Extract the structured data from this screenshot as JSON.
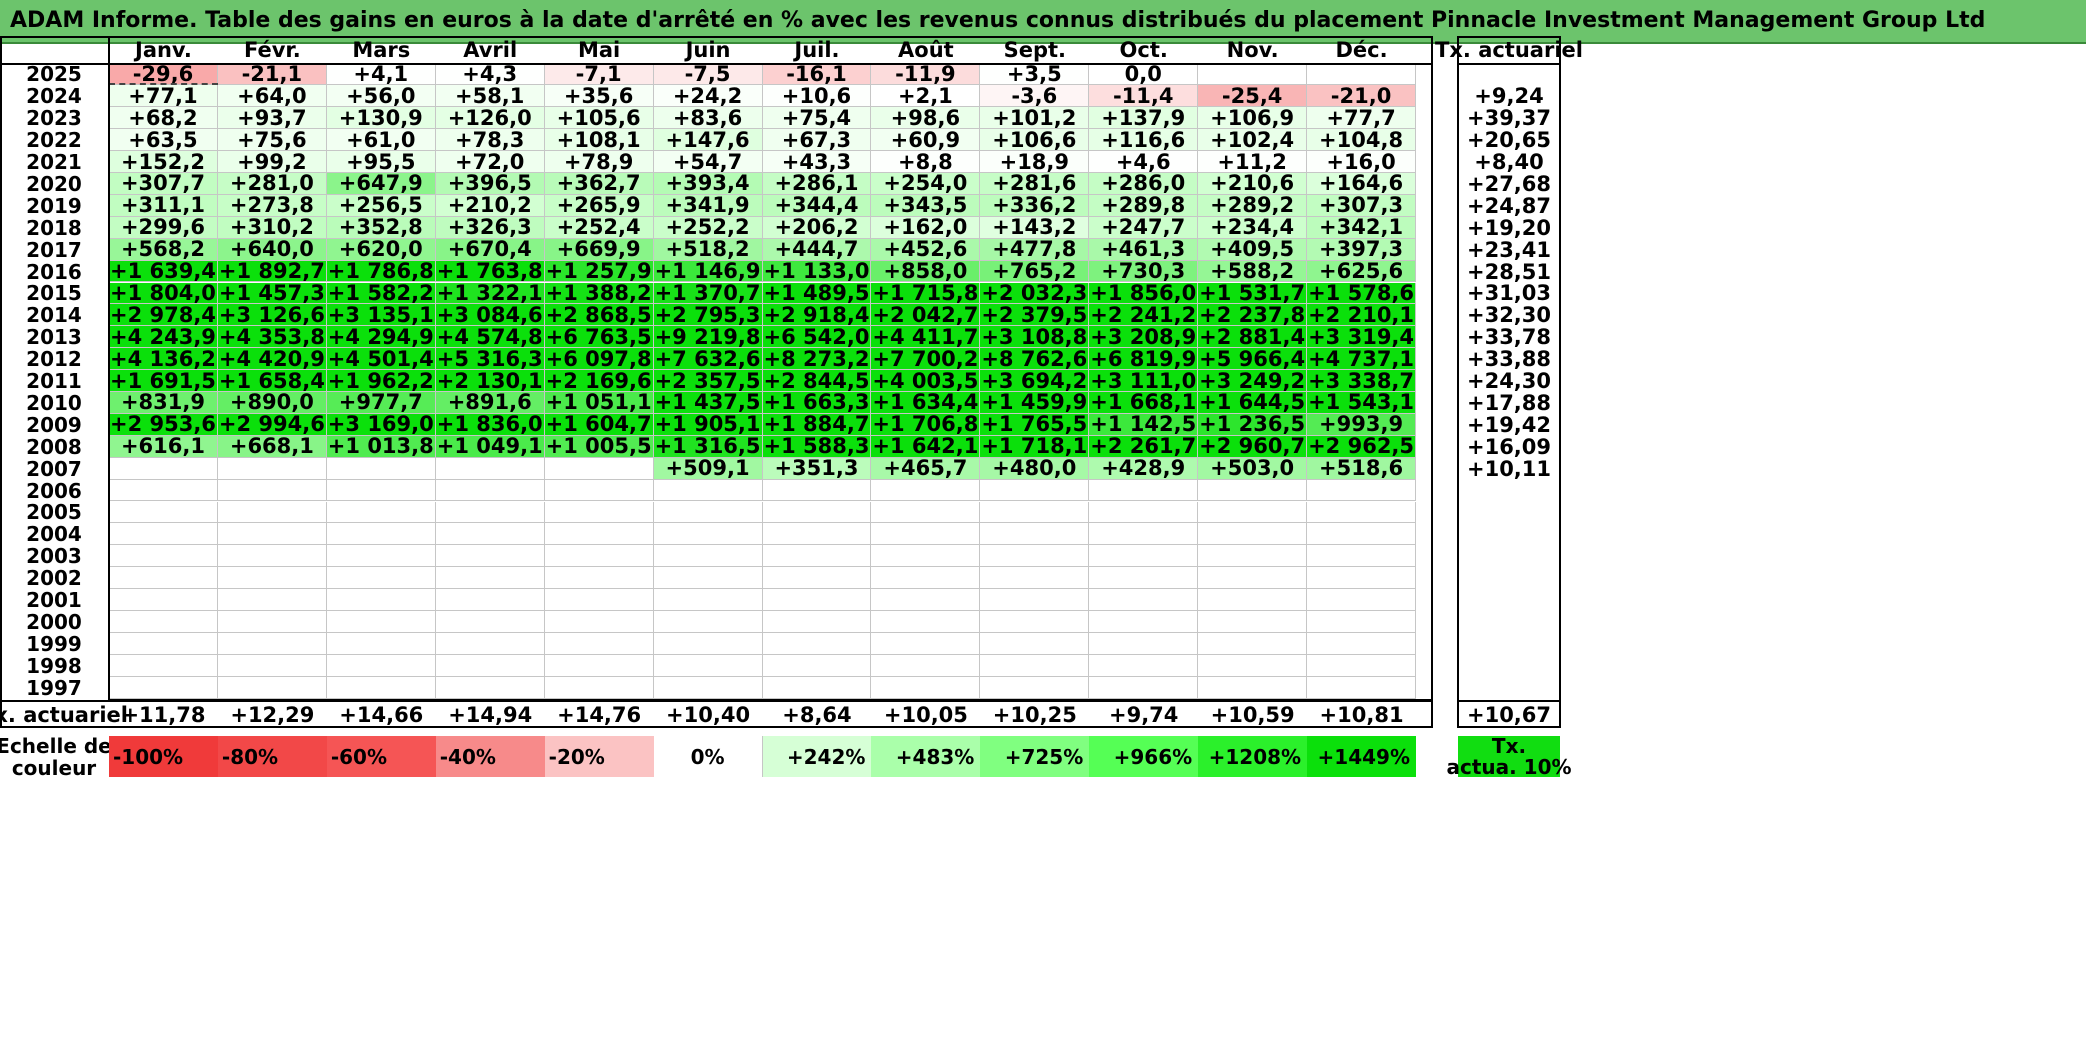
{
  "title": "ADAM Informe. Table des gains en euros à la date d'arrêté en % avec les revenus connus distribués du placement Pinnacle Investment Management Group Ltd",
  "months": [
    "Janv.",
    "Févr.",
    "Mars",
    "Avril",
    "Mai",
    "Juin",
    "Juil.",
    "Août",
    "Sept.",
    "Oct.",
    "Nov.",
    "Déc."
  ],
  "tx_header": "Tx. actuariel",
  "rows": [
    {
      "year": "2025",
      "values": [
        "-29,6",
        "-21,1",
        "+4,1",
        "+4,3",
        "-7,1",
        "-7,5",
        "-16,1",
        "-11,9",
        "+3,5",
        "0,0",
        "",
        ""
      ],
      "tx": ""
    },
    {
      "year": "2024",
      "values": [
        "+77,1",
        "+64,0",
        "+56,0",
        "+58,1",
        "+35,6",
        "+24,2",
        "+10,6",
        "+2,1",
        "-3,6",
        "-11,4",
        "-25,4",
        "-21,0"
      ],
      "tx": "+9,24"
    },
    {
      "year": "2023",
      "values": [
        "+68,2",
        "+93,7",
        "+130,9",
        "+126,0",
        "+105,6",
        "+83,6",
        "+75,4",
        "+98,6",
        "+101,2",
        "+137,9",
        "+106,9",
        "+77,7"
      ],
      "tx": "+39,37"
    },
    {
      "year": "2022",
      "values": [
        "+63,5",
        "+75,6",
        "+61,0",
        "+78,3",
        "+108,1",
        "+147,6",
        "+67,3",
        "+60,9",
        "+106,6",
        "+116,6",
        "+102,4",
        "+104,8"
      ],
      "tx": "+20,65"
    },
    {
      "year": "2021",
      "values": [
        "+152,2",
        "+99,2",
        "+95,5",
        "+72,0",
        "+78,9",
        "+54,7",
        "+43,3",
        "+8,8",
        "+18,9",
        "+4,6",
        "+11,2",
        "+16,0"
      ],
      "tx": "+8,40"
    },
    {
      "year": "2020",
      "values": [
        "+307,7",
        "+281,0",
        "+647,9",
        "+396,5",
        "+362,7",
        "+393,4",
        "+286,1",
        "+254,0",
        "+281,6",
        "+286,0",
        "+210,6",
        "+164,6"
      ],
      "tx": "+27,68"
    },
    {
      "year": "2019",
      "values": [
        "+311,1",
        "+273,8",
        "+256,5",
        "+210,2",
        "+265,9",
        "+341,9",
        "+344,4",
        "+343,5",
        "+336,2",
        "+289,8",
        "+289,2",
        "+307,3"
      ],
      "tx": "+24,87"
    },
    {
      "year": "2018",
      "values": [
        "+299,6",
        "+310,2",
        "+352,8",
        "+326,3",
        "+252,4",
        "+252,2",
        "+206,2",
        "+162,0",
        "+143,2",
        "+247,7",
        "+234,4",
        "+342,1"
      ],
      "tx": "+19,20"
    },
    {
      "year": "2017",
      "values": [
        "+568,2",
        "+640,0",
        "+620,0",
        "+670,4",
        "+669,9",
        "+518,2",
        "+444,7",
        "+452,6",
        "+477,8",
        "+461,3",
        "+409,5",
        "+397,3"
      ],
      "tx": "+23,41"
    },
    {
      "year": "2016",
      "values": [
        "+1 639,4",
        "+1 892,7",
        "+1 786,8",
        "+1 763,8",
        "+1 257,9",
        "+1 146,9",
        "+1 133,0",
        "+858,0",
        "+765,2",
        "+730,3",
        "+588,2",
        "+625,6"
      ],
      "tx": "+28,51"
    },
    {
      "year": "2015",
      "values": [
        "+1 804,0",
        "+1 457,3",
        "+1 582,2",
        "+1 322,1",
        "+1 388,2",
        "+1 370,7",
        "+1 489,5",
        "+1 715,8",
        "+2 032,3",
        "+1 856,0",
        "+1 531,7",
        "+1 578,6"
      ],
      "tx": "+31,03"
    },
    {
      "year": "2014",
      "values": [
        "+2 978,4",
        "+3 126,6",
        "+3 135,1",
        "+3 084,6",
        "+2 868,5",
        "+2 795,3",
        "+2 918,4",
        "+2 042,7",
        "+2 379,5",
        "+2 241,2",
        "+2 237,8",
        "+2 210,1"
      ],
      "tx": "+32,30"
    },
    {
      "year": "2013",
      "values": [
        "+4 243,9",
        "+4 353,8",
        "+4 294,9",
        "+4 574,8",
        "+6 763,5",
        "+9 219,8",
        "+6 542,0",
        "+4 411,7",
        "+3 108,8",
        "+3 208,9",
        "+2 881,4",
        "+3 319,4"
      ],
      "tx": "+33,78"
    },
    {
      "year": "2012",
      "values": [
        "+4 136,2",
        "+4 420,9",
        "+4 501,4",
        "+5 316,3",
        "+6 097,8",
        "+7 632,6",
        "+8 273,2",
        "+7 700,2",
        "+8 762,6",
        "+6 819,9",
        "+5 966,4",
        "+4 737,1"
      ],
      "tx": "+33,88"
    },
    {
      "year": "2011",
      "values": [
        "+1 691,5",
        "+1 658,4",
        "+1 962,2",
        "+2 130,1",
        "+2 169,6",
        "+2 357,5",
        "+2 844,5",
        "+4 003,5",
        "+3 694,2",
        "+3 111,0",
        "+3 249,2",
        "+3 338,7"
      ],
      "tx": "+24,30"
    },
    {
      "year": "2010",
      "values": [
        "+831,9",
        "+890,0",
        "+977,7",
        "+891,6",
        "+1 051,1",
        "+1 437,5",
        "+1 663,3",
        "+1 634,4",
        "+1 459,9",
        "+1 668,1",
        "+1 644,5",
        "+1 543,1"
      ],
      "tx": "+17,88"
    },
    {
      "year": "2009",
      "values": [
        "+2 953,6",
        "+2 994,6",
        "+3 169,0",
        "+1 836,0",
        "+1 604,7",
        "+1 905,1",
        "+1 884,7",
        "+1 706,8",
        "+1 765,5",
        "+1 142,5",
        "+1 236,5",
        "+993,9"
      ],
      "tx": "+19,42"
    },
    {
      "year": "2008",
      "values": [
        "+616,1",
        "+668,1",
        "+1 013,8",
        "+1 049,1",
        "+1 005,5",
        "+1 316,5",
        "+1 588,3",
        "+1 642,1",
        "+1 718,1",
        "+2 261,7",
        "+2 960,7",
        "+2 962,5"
      ],
      "tx": "+16,09"
    },
    {
      "year": "2007",
      "values": [
        "",
        "",
        "",
        "",
        "",
        "+509,1",
        "+351,3",
        "+465,7",
        "+480,0",
        "+428,9",
        "+503,0",
        "+518,6"
      ],
      "tx": "+10,11"
    },
    {
      "year": "2006",
      "values": [
        "",
        "",
        "",
        "",
        "",
        "",
        "",
        "",
        "",
        "",
        "",
        ""
      ],
      "tx": ""
    },
    {
      "year": "2005",
      "values": [
        "",
        "",
        "",
        "",
        "",
        "",
        "",
        "",
        "",
        "",
        "",
        ""
      ],
      "tx": ""
    },
    {
      "year": "2004",
      "values": [
        "",
        "",
        "",
        "",
        "",
        "",
        "",
        "",
        "",
        "",
        "",
        ""
      ],
      "tx": ""
    },
    {
      "year": "2003",
      "values": [
        "",
        "",
        "",
        "",
        "",
        "",
        "",
        "",
        "",
        "",
        "",
        ""
      ],
      "tx": ""
    },
    {
      "year": "2002",
      "values": [
        "",
        "",
        "",
        "",
        "",
        "",
        "",
        "",
        "",
        "",
        "",
        ""
      ],
      "tx": ""
    },
    {
      "year": "2001",
      "values": [
        "",
        "",
        "",
        "",
        "",
        "",
        "",
        "",
        "",
        "",
        "",
        ""
      ],
      "tx": ""
    },
    {
      "year": "2000",
      "values": [
        "",
        "",
        "",
        "",
        "",
        "",
        "",
        "",
        "",
        "",
        "",
        ""
      ],
      "tx": ""
    },
    {
      "year": "1999",
      "values": [
        "",
        "",
        "",
        "",
        "",
        "",
        "",
        "",
        "",
        "",
        "",
        ""
      ],
      "tx": ""
    },
    {
      "year": "1998",
      "values": [
        "",
        "",
        "",
        "",
        "",
        "",
        "",
        "",
        "",
        "",
        "",
        ""
      ],
      "tx": ""
    },
    {
      "year": "1997",
      "values": [
        "",
        "",
        "",
        "",
        "",
        "",
        "",
        "",
        "",
        "",
        "",
        ""
      ],
      "tx": ""
    }
  ],
  "footer": {
    "label": "Tx. actuariel",
    "values": [
      "+11,78",
      "+12,29",
      "+14,66",
      "+14,94",
      "+14,76",
      "+10,40",
      "+8,64",
      "+10,05",
      "+10,25",
      "+9,74",
      "+10,59",
      "+10,81"
    ],
    "total": "+10,67"
  },
  "legend": {
    "label_line1": "Echelle de",
    "label_line2": "couleur",
    "items": [
      {
        "text": "-100%",
        "color": "#f03a3a"
      },
      {
        "text": "-80%",
        "color": "#f24848"
      },
      {
        "text": "-60%",
        "color": "#f55555"
      },
      {
        "text": "-40%",
        "color": "#f78a8a"
      },
      {
        "text": "-20%",
        "color": "#fbc3c3"
      },
      {
        "text": "0%",
        "color": "#ffffff"
      },
      {
        "text": "+242%",
        "color": "#d6ffd6"
      },
      {
        "text": "+483%",
        "color": "#aaffaa"
      },
      {
        "text": "+725%",
        "color": "#80ff80"
      },
      {
        "text": "+966%",
        "color": "#55ff55"
      },
      {
        "text": "+1208%",
        "color": "#2bf02b"
      },
      {
        "text": "+1449%",
        "color": "#0be00b"
      }
    ],
    "tx_label_line1": "Tx.",
    "tx_label_line2": "actua. 10%",
    "tx_color": "#11dd11"
  },
  "colors": {
    "title_bg": "#6cc46c",
    "negative_max": "#f03a3a",
    "positive_max": "#0be00b"
  }
}
